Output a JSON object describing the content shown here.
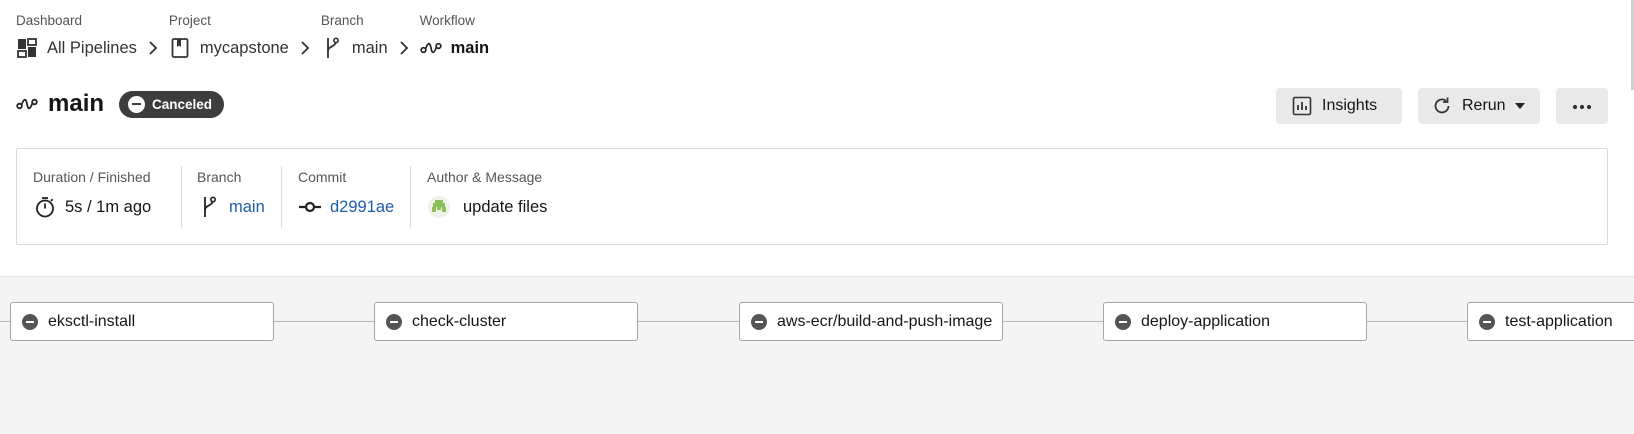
{
  "breadcrumb": [
    {
      "label": "Dashboard",
      "value": "All Pipelines",
      "icon": "dashboard-icon"
    },
    {
      "label": "Project",
      "value": "mycapstone",
      "icon": "project-icon"
    },
    {
      "label": "Branch",
      "value": "main",
      "icon": "branch-icon"
    },
    {
      "label": "Workflow",
      "value": "main",
      "icon": "workflow-icon"
    }
  ],
  "header": {
    "title": "main",
    "status": "Canceled",
    "icon": "workflow-icon"
  },
  "actions": {
    "insights_label": "Insights",
    "rerun_label": "Rerun",
    "more_label": "•••"
  },
  "info": {
    "duration": {
      "label": "Duration / Finished",
      "value": "5s / 1m ago",
      "icon": "timer-icon"
    },
    "branch": {
      "label": "Branch",
      "value": "main",
      "icon": "branch-icon"
    },
    "commit": {
      "label": "Commit",
      "value": "d2991ae",
      "icon": "commit-icon"
    },
    "author": {
      "label": "Author & Message",
      "value": "update files",
      "icon": "avatar"
    }
  },
  "jobs": [
    {
      "name": "eksctl-install",
      "status": "canceled"
    },
    {
      "name": "check-cluster",
      "status": "canceled"
    },
    {
      "name": "aws-ecr/build-and-push-image",
      "status": "canceled"
    },
    {
      "name": "deploy-application",
      "status": "canceled"
    },
    {
      "name": "test-application",
      "status": "canceled"
    }
  ],
  "colors": {
    "link": "#1a5ea8",
    "badge": "#3d3d3d",
    "button": "#e9e9e9",
    "canvas": "#f4f4f4"
  }
}
